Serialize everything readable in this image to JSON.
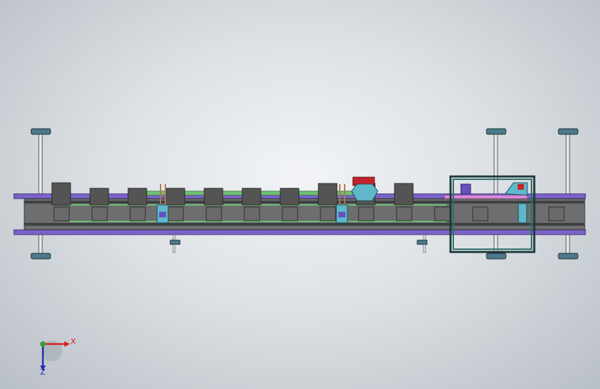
{
  "viewport": {
    "background_center": "#f2f4f6",
    "background_edge": "#b9bfc6"
  },
  "model": {
    "rail_color": "#7b63c9",
    "conveyor_green": "#6fbf73",
    "module_dark": "#545454",
    "module_light": "#6a6a6a",
    "cyan_part": "#5fb7c9",
    "red_part": "#c4232b",
    "pink_rod": "#d98ad9",
    "frame_teal": "#2f6f6a"
  },
  "triad": {
    "x_label": "X",
    "z_label": "Z",
    "x_color": "#d42020",
    "y_color": "#2fa52f",
    "z_color": "#1e2fb8"
  }
}
